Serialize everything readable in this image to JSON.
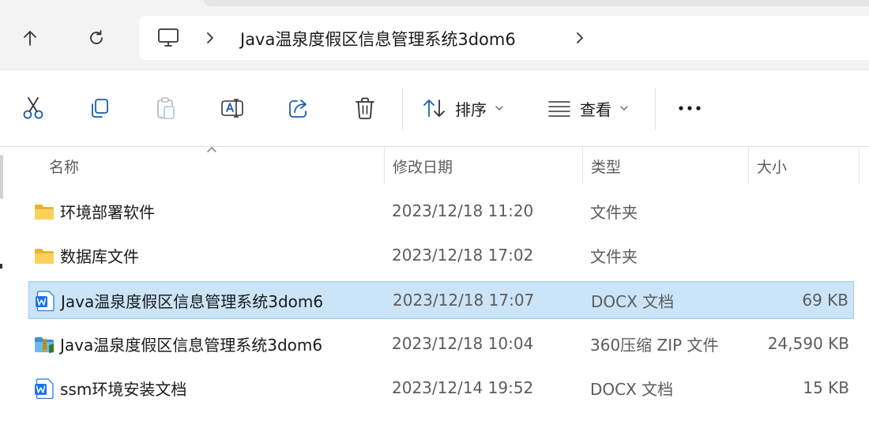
{
  "address_bar": {
    "path_segment": "Java温泉度假区信息管理系统3dom6",
    "up_icon": "arrow-up-icon",
    "refresh_icon": "refresh-icon",
    "location_icon": "monitor-icon"
  },
  "toolbar": {
    "sort_label": "排序",
    "view_label": "查看",
    "icons": [
      "cut-icon",
      "copy-icon",
      "paste-icon",
      "rename-icon",
      "share-icon",
      "delete-icon",
      "more-icon"
    ]
  },
  "columns": {
    "name": "名称",
    "date": "修改日期",
    "type": "类型",
    "size": "大小"
  },
  "files": [
    {
      "name": "环境部署软件",
      "date": "2023/12/18 11:20",
      "type": "文件夹",
      "size": "",
      "icon": "folder-icon",
      "selected": false
    },
    {
      "name": "数据库文件",
      "date": "2023/12/18 17:02",
      "type": "文件夹",
      "size": "",
      "icon": "folder-icon",
      "selected": false
    },
    {
      "name": "Java温泉度假区信息管理系统3dom6",
      "date": "2023/12/18 17:07",
      "type": "DOCX 文档",
      "size": "69 KB",
      "icon": "word-doc-icon",
      "selected": true
    },
    {
      "name": "Java温泉度假区信息管理系统3dom6",
      "date": "2023/12/18 10:04",
      "type": "360压缩 ZIP 文件",
      "size": "24,590 KB",
      "icon": "zip-archive-icon",
      "selected": false
    },
    {
      "name": "ssm环境安装文档",
      "date": "2023/12/14 19:52",
      "type": "DOCX 文档",
      "size": "15 KB",
      "icon": "word-doc-icon",
      "selected": false
    }
  ],
  "colors": {
    "selection_bg": "#cce4f7",
    "selection_border": "#99c9ef",
    "folder": "#f8c845",
    "word_blue": "#1a73e8"
  }
}
